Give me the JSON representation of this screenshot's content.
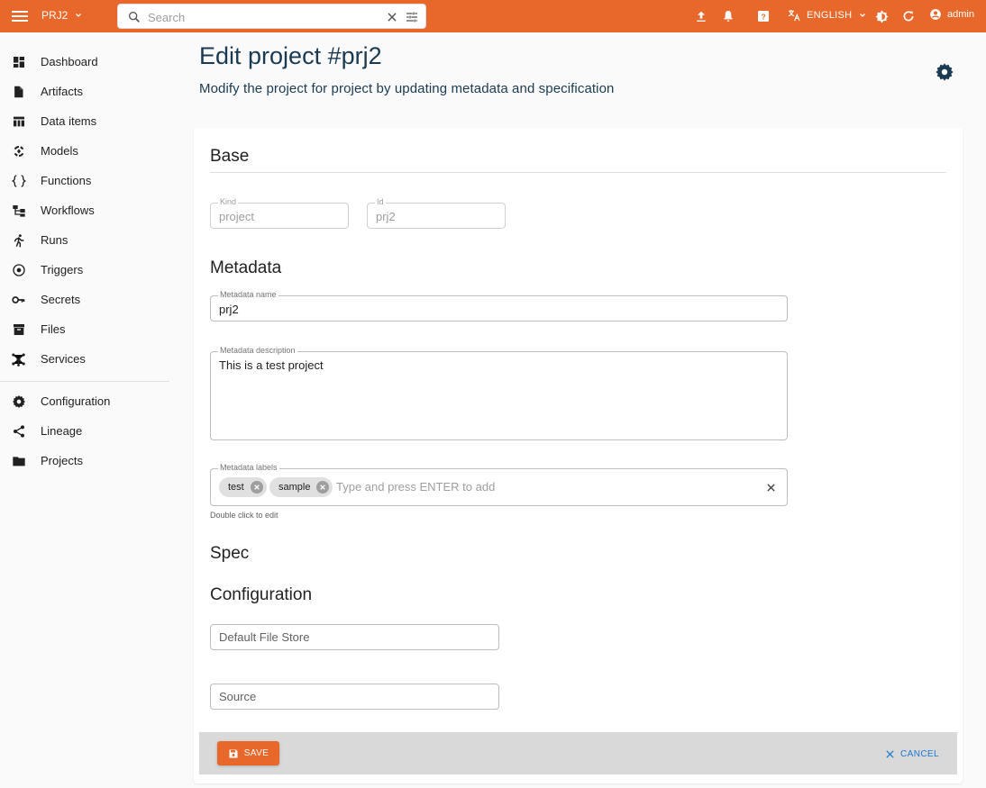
{
  "topbar": {
    "project": "PRJ2",
    "search_placeholder": "Search",
    "language": "ENGLISH",
    "user": "admin"
  },
  "sidebar": {
    "items": [
      {
        "label": "Dashboard",
        "icon": "dashboard-icon"
      },
      {
        "label": "Artifacts",
        "icon": "file-icon"
      },
      {
        "label": "Data items",
        "icon": "table-icon"
      },
      {
        "label": "Models",
        "icon": "model-icon"
      },
      {
        "label": "Functions",
        "icon": "braces-icon"
      },
      {
        "label": "Workflows",
        "icon": "workflow-icon"
      },
      {
        "label": "Runs",
        "icon": "run-icon"
      },
      {
        "label": "Triggers",
        "icon": "trigger-icon"
      },
      {
        "label": "Secrets",
        "icon": "key-icon"
      },
      {
        "label": "Files",
        "icon": "archive-icon"
      },
      {
        "label": "Services",
        "icon": "hub-icon"
      }
    ],
    "bottom_items": [
      {
        "label": "Configuration",
        "icon": "gear-icon"
      },
      {
        "label": "Lineage",
        "icon": "share-icon"
      },
      {
        "label": "Projects",
        "icon": "folder-icon"
      }
    ]
  },
  "main": {
    "title": "Edit project #prj2",
    "subtitle": "Modify the project for project by updating metadata and specification",
    "sections": {
      "base": "Base",
      "metadata": "Metadata",
      "spec": "Spec",
      "configuration": "Configuration"
    },
    "fields": {
      "kind": {
        "label": "Kind",
        "value": "project"
      },
      "id": {
        "label": "Id",
        "value": "prj2"
      },
      "metadata_name": {
        "label": "Metadata name",
        "value": "prj2"
      },
      "metadata_description": {
        "label": "Metadata description",
        "value": "This is a test project"
      },
      "metadata_labels": {
        "label": "Metadata labels",
        "chips": [
          "test",
          "sample"
        ],
        "placeholder": "Type and press ENTER to add",
        "helper": "Double click to edit"
      },
      "default_file_store": {
        "placeholder": "Default File Store"
      },
      "source": {
        "placeholder": "Source"
      }
    },
    "actions": {
      "save": "SAVE",
      "cancel": "CANCEL"
    }
  },
  "colors": {
    "accent": "#e8672a",
    "link": "#1976d2",
    "title": "#1a3a52"
  }
}
